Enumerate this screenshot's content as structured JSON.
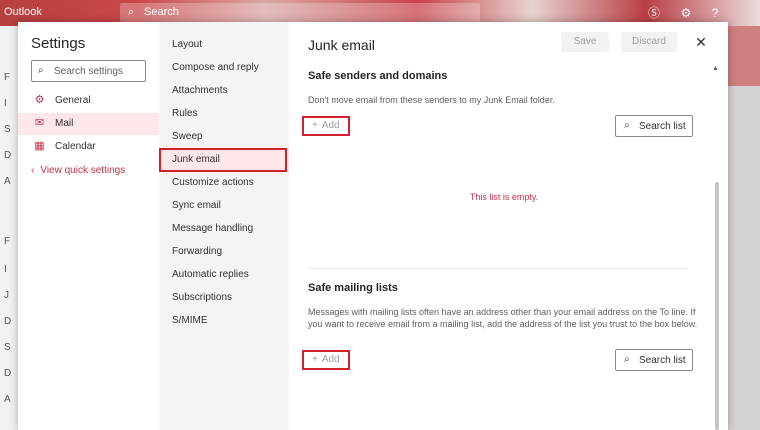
{
  "app": {
    "name": "Outlook",
    "search_placeholder": "Search",
    "left_rail_letters": [
      "F",
      "I",
      "S",
      "D",
      "A",
      "F",
      "I",
      "J",
      "D",
      "S",
      "D",
      "A"
    ]
  },
  "settings": {
    "title": "Settings",
    "search_placeholder": "Search settings",
    "categories": [
      {
        "label": "General",
        "icon": "gear-icon",
        "glyph": "⚙"
      },
      {
        "label": "Mail",
        "icon": "mail-icon",
        "glyph": "✉"
      },
      {
        "label": "Calendar",
        "icon": "calendar-icon",
        "glyph": "▦"
      }
    ],
    "quick_settings": "View quick settings"
  },
  "mail_nav": {
    "items": [
      "Layout",
      "Compose and reply",
      "Attachments",
      "Rules",
      "Sweep",
      "Junk email",
      "Customize actions",
      "Sync email",
      "Message handling",
      "Forwarding",
      "Automatic replies",
      "Subscriptions",
      "S/MIME"
    ],
    "selected": "Junk email"
  },
  "page": {
    "title": "Junk email",
    "save_label": "Save",
    "discard_label": "Discard",
    "close_glyph": "✕"
  },
  "safe_senders": {
    "title": "Safe senders and domains",
    "description": "Don't move email from these senders to my Junk Email folder.",
    "add_label": "Add",
    "search_label": "Search list",
    "empty_text": "This list is empty."
  },
  "safe_mailing": {
    "title": "Safe mailing lists",
    "description": "Messages with mailing lists often have an address other than your email address on the To line. If you want to receive email from a mailing list, add the address of the list you trust to the box below.",
    "add_label": "Add",
    "search_label": "Search list"
  },
  "colors": {
    "accent": "#c4314b",
    "highlight_box": "#d0202c",
    "selected_bg": "#fde7e9"
  }
}
